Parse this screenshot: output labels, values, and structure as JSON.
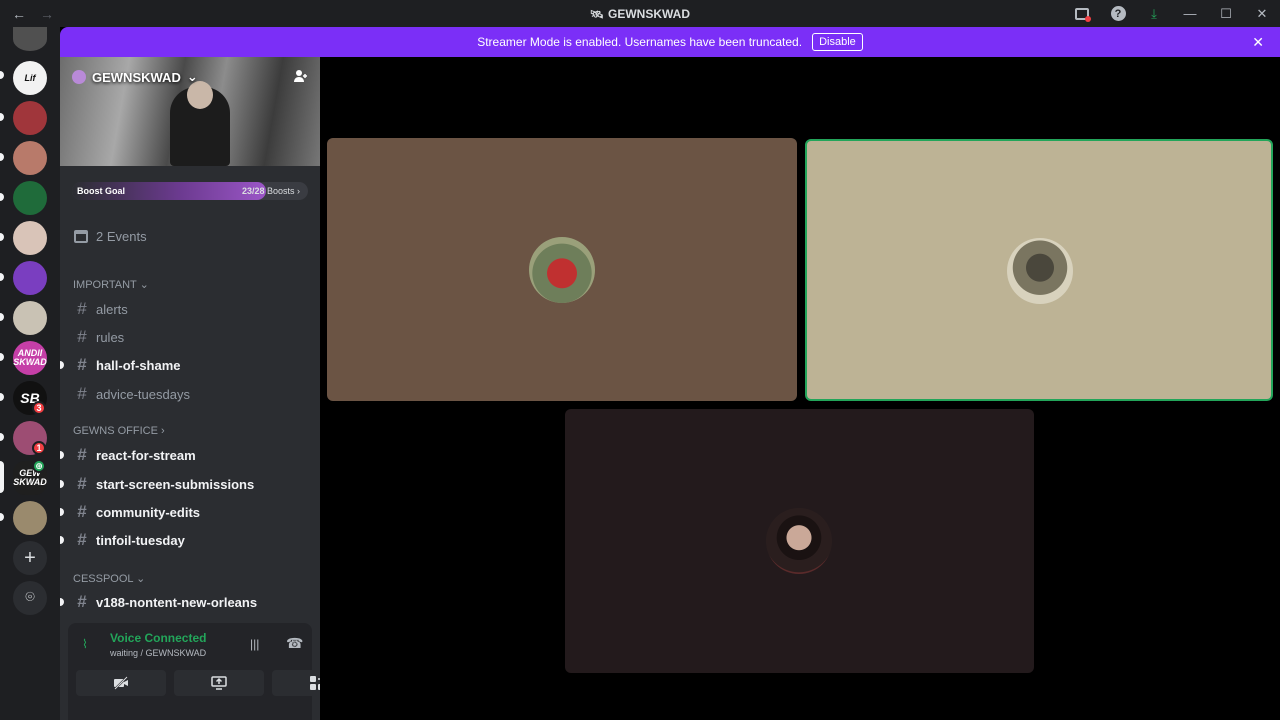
{
  "titlebar": {
    "back": "←",
    "forward": "→",
    "title": "GEWNSKWAD",
    "title_icon": "🛰",
    "icons": [
      "screen-share-icon",
      "help-icon",
      "download-icon",
      "minimize-icon",
      "maximize-icon",
      "close-icon"
    ],
    "help_glyph": "?",
    "download_glyph": "⤓",
    "minimize_glyph": "—",
    "maximize_glyph": "☐",
    "close_glyph": "✕"
  },
  "banner": {
    "text": "Streamer Mode is enabled. Usernames have been truncated.",
    "button": "Disable",
    "close": "✕"
  },
  "rail": {
    "servers": [
      {
        "name": "server-1",
        "color": "#505050"
      },
      {
        "name": "server-2",
        "color": "#f2f2f2",
        "text": "Lif"
      },
      {
        "name": "server-3",
        "color": "#a0363b"
      },
      {
        "name": "server-4",
        "color": "#b87a6a"
      },
      {
        "name": "server-5",
        "color": "#1f6b3a"
      },
      {
        "name": "server-6",
        "color": "#d9c4b8"
      },
      {
        "name": "server-7",
        "color": "#7a3ec0"
      },
      {
        "name": "server-8",
        "color": "#c9c2b4"
      },
      {
        "name": "server-9",
        "color": "#c53fa7",
        "text": "ANDII SKWAD"
      },
      {
        "name": "server-10",
        "color": "#111111",
        "text": "SB",
        "badge": "3"
      },
      {
        "name": "server-11",
        "color": "#9d4d73",
        "badge": "1"
      },
      {
        "name": "server-12",
        "color": "#1f1f1f",
        "text": "GEW SKWAD",
        "badge": "⊕"
      },
      {
        "name": "server-13",
        "color": "#9a8a6d"
      }
    ],
    "add": "+",
    "explore": "⌾"
  },
  "server": {
    "name": "GEWNSKWAD",
    "chevron": "⌄",
    "boost_label": "Boost Goal",
    "boost_count": "23/28",
    "boost_suffix": "Boosts",
    "boost_progress": 0.82,
    "events": "2 Events"
  },
  "categories": {
    "important": "IMPORTANT",
    "office": "GEWNS OFFICE",
    "cesspool": "CESSPOOL"
  },
  "channels": {
    "alerts": "alerts",
    "rules": "rules",
    "hall": "hall-of-shame",
    "advice": "advice-tuesdays",
    "react": "react-for-stream",
    "start": "start-screen-submissions",
    "community": "community-edits",
    "tinfoil": "tinfoil-tuesday",
    "v188": "v188-nontent-new-orleans"
  },
  "hash": "#",
  "voice": {
    "status": "Voice Connected",
    "subtitle": "waiting / GEWNSKWAD",
    "signal_icon": "⌇",
    "noise_icon": "|||",
    "disconnect_icon": "☎",
    "buttons": [
      "camera-off-icon",
      "screen-share-icon",
      "activities-icon"
    ]
  },
  "tiles": [
    {
      "name": "participant-tile-1",
      "bg": "#6b5444",
      "avatar": "#a84a3a"
    },
    {
      "name": "participant-tile-2",
      "bg": "#bdb395",
      "avatar": "#6e6a58",
      "speaking": true
    },
    {
      "name": "participant-tile-3",
      "bg": "#231a1c",
      "avatar": "#3a2a2a"
    }
  ]
}
